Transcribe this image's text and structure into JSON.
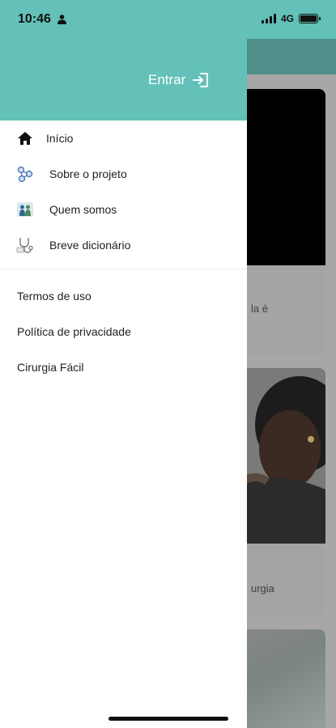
{
  "status_bar": {
    "time": "10:46",
    "network": "4G"
  },
  "drawer": {
    "login_label": "Entrar",
    "menu": [
      {
        "label": "Início",
        "icon": "home-icon"
      },
      {
        "label": "Sobre o projeto",
        "icon": "molecule-icon"
      },
      {
        "label": "Quem somos",
        "icon": "team-icon"
      },
      {
        "label": "Breve dicionário",
        "icon": "stethoscope-icon"
      }
    ],
    "links": [
      {
        "label": "Termos de uso"
      },
      {
        "label": "Política de privacidade"
      },
      {
        "label": "Cirurgia Fácil"
      }
    ]
  },
  "background": {
    "card1_caption": "la é",
    "card2_caption": "urgia"
  },
  "colors": {
    "accent": "#63c1b9",
    "drawer_bg": "#ffffff",
    "text": "#222222"
  }
}
